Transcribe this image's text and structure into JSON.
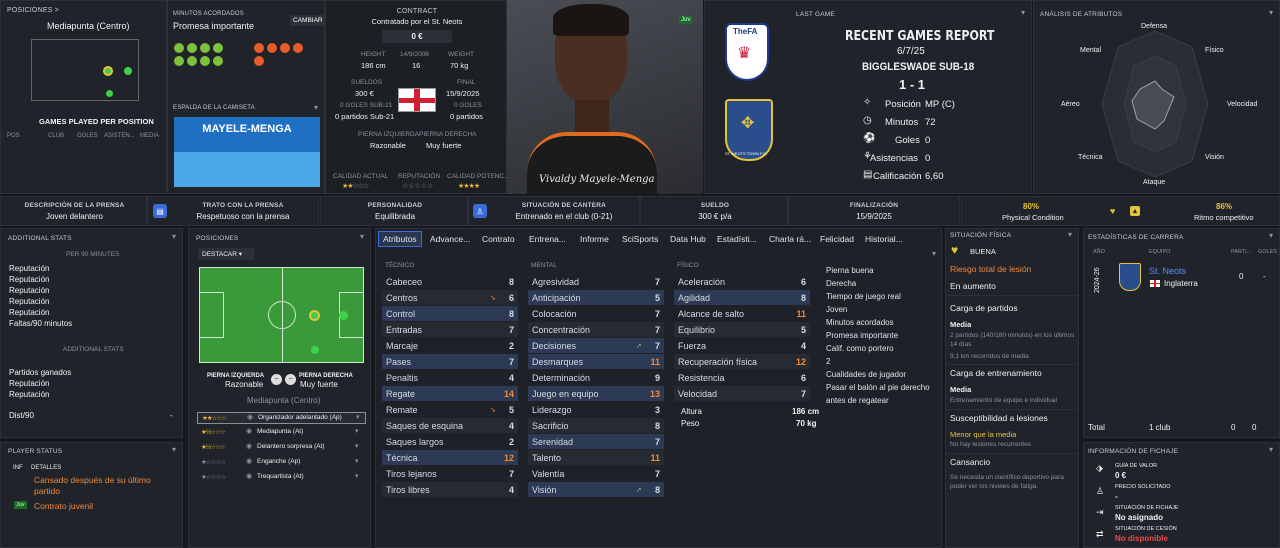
{
  "top": {
    "pos_link": "POSICIONES >",
    "pos_main": "Mediapunta (Centro)",
    "games_per_pos": "GAMES PLAYED PER POSITION",
    "gp_cols": [
      "POS",
      "CLUB",
      "GOLES",
      "ASISTEN...",
      "MEDIA"
    ],
    "minutes_title": "MINUTOS ACORDADOS",
    "minutes_value": "Promesa importante",
    "cambiar": "CAMBIAR",
    "shirt_title": "ESPALDA DE LA CAMISETA",
    "shirt_name": "MAYELE-MENGA",
    "contract_title": "CONTRACT",
    "contract_sub": "Contratado por el St. Neots",
    "contract_value": "0 €",
    "height_l": "HEIGHT",
    "height_v": "186 cm",
    "dob": "14/9/2008",
    "age": "16",
    "weight_l": "WEIGHT",
    "weight_v": "70 kg",
    "wage_l": "SUELDOS",
    "wage_v": "300 €",
    "final_l": "FINAL",
    "final_v": "15/9/2025",
    "goals_l": "0 GOLES SUB-21",
    "goals_v": "0 partidos Sub-21",
    "goals2_l": "0 GOLES",
    "goals2_v": "0 partidos",
    "foot_l_title": "PIERNA IZQUIERDA",
    "foot_l": "Razonable",
    "foot_r_title": "PIERNA DERECHA",
    "foot_r": "Muy fuerte",
    "ca_l": "CALIDAD ACTUAL",
    "rep_l": "REPUTACIÓN",
    "pa_l": "CALIDAD POTENC...",
    "player_name": "Vivaldy Mayele-Menga",
    "youth_badge": "Juv",
    "last_game": "LAST GAME",
    "report_title": "RECENT GAMES REPORT",
    "report_date": "6/7/25",
    "report_team": "BIGGLESWADE SUB-18",
    "report_score": "1 - 1",
    "fa_logo": "TheFA",
    "stn_logo": "ST. NEOTS TOWN F.C.",
    "rep_rows": [
      {
        "l": "Posición",
        "v": "MP (C)"
      },
      {
        "l": "Minutos",
        "v": "72"
      },
      {
        "l": "Goles",
        "v": "0"
      },
      {
        "l": "Asistencias",
        "v": "0"
      },
      {
        "l": "Calificación",
        "v": "6,60"
      }
    ],
    "attr_title": "ANÁLISIS DE ATRIBUTOS",
    "radar": [
      "Defensa",
      "Físico",
      "Velocidad",
      "Visión",
      "Ataque",
      "Técnica",
      "Aéreo",
      "Mental"
    ]
  },
  "strip": [
    {
      "t": "DESCRIPCIÓN DE LA PRENSA",
      "v": "Joven delantero"
    },
    {
      "t": "TRATO CON LA PRENSA",
      "v": "Respetuoso con la prensa"
    },
    {
      "t": "PERSONALIDAD",
      "v": "Equilibrada"
    },
    {
      "t": "SITUACIÓN DE CANTERA",
      "v": "Entrenado en el club (0-21)"
    },
    {
      "t": "SUELDO",
      "v": "300 € p/a"
    },
    {
      "t": "FINALIZACIÓN",
      "v": "15/9/2025"
    },
    {
      "t": "80%",
      "v": "Physical Condition"
    },
    {
      "t": "86%",
      "v": "Ritmo competitivo"
    }
  ],
  "left": {
    "title": "ADDITIONAL STATS",
    "sub1": "PER 90 MINUTES",
    "items1": [
      "Reputación",
      "Reputación",
      "Reputación",
      "Reputación",
      "Reputación",
      "Faltas/90 minutos"
    ],
    "sub2": "ADDITIONAL STATS",
    "items2": [
      "Partidos ganados",
      "Reputación",
      "Reputación"
    ],
    "dist": "Dist/90",
    "dist_v": "-",
    "status_title": "PLAYER STATUS",
    "col1": "INF",
    "col2": "DETALLES",
    "status1": "Cansado después de su último partido",
    "status2": "Contrato juvenil",
    "juv": "Juv"
  },
  "positions": {
    "title": "POSICIONES",
    "dropdown": "DESTACAR",
    "foot_l_title": "PIERNA IZQUIERDA",
    "foot_l": "Razonable",
    "foot_r_title": "PIERNA DERECHA",
    "foot_r": "Muy fuerte",
    "main": "Mediapunta (Centro)",
    "roles": [
      {
        "s": "★★☆☆☆",
        "n": "Organizador adelantado (Ap)"
      },
      {
        "s": "★½☆☆☆",
        "n": "Mediapunta (At)"
      },
      {
        "s": "★½☆☆☆",
        "n": "Delantero sorpresa (At)"
      },
      {
        "s": "★☆☆☆☆",
        "n": "Enganche (Ap)"
      },
      {
        "s": "★☆☆☆☆",
        "n": "Trequartista (At)"
      }
    ]
  },
  "tabs": [
    "Atributos",
    "Advance...",
    "Contrato",
    "Entrena...",
    "Informe",
    "SciSports",
    "Data Hub",
    "Estadísti...",
    "Charla rá...",
    "Felicidad",
    "Historial..."
  ],
  "attrs": {
    "tec_h": "TÉCNICO",
    "men_h": "MENTAL",
    "fis_h": "FÍSICO",
    "tec": [
      {
        "n": "Cabeceo",
        "v": "8"
      },
      {
        "n": "Centros",
        "v": "6"
      },
      {
        "n": "Control",
        "v": "8"
      },
      {
        "n": "Entradas",
        "v": "7"
      },
      {
        "n": "Marcaje",
        "v": "2"
      },
      {
        "n": "Pases",
        "v": "7"
      },
      {
        "n": "Penaltis",
        "v": "4"
      },
      {
        "n": "Regate",
        "v": "14"
      },
      {
        "n": "Remate",
        "v": "5"
      },
      {
        "n": "Saques de esquina",
        "v": "4"
      },
      {
        "n": "Saques largos",
        "v": "2"
      },
      {
        "n": "Técnica",
        "v": "12"
      },
      {
        "n": "Tiros lejanos",
        "v": "7"
      },
      {
        "n": "Tiros libres",
        "v": "4"
      }
    ],
    "men": [
      {
        "n": "Agresividad",
        "v": "7"
      },
      {
        "n": "Anticipación",
        "v": "5"
      },
      {
        "n": "Colocación",
        "v": "7"
      },
      {
        "n": "Concentración",
        "v": "7"
      },
      {
        "n": "Decisiones",
        "v": "7"
      },
      {
        "n": "Desmarques",
        "v": "11"
      },
      {
        "n": "Determinación",
        "v": "9"
      },
      {
        "n": "Juego en equipo",
        "v": "13"
      },
      {
        "n": "Liderazgo",
        "v": "3"
      },
      {
        "n": "Sacrificio",
        "v": "8"
      },
      {
        "n": "Serenidad",
        "v": "7"
      },
      {
        "n": "Talento",
        "v": "11"
      },
      {
        "n": "Valentía",
        "v": "7"
      },
      {
        "n": "Visión",
        "v": "8"
      }
    ],
    "fis": [
      {
        "n": "Aceleración",
        "v": "6"
      },
      {
        "n": "Agilidad",
        "v": "8"
      },
      {
        "n": "Alcance de salto",
        "v": "11"
      },
      {
        "n": "Equilibrio",
        "v": "5"
      },
      {
        "n": "Fuerza",
        "v": "4"
      },
      {
        "n": "Recuperación física",
        "v": "12"
      },
      {
        "n": "Resistencia",
        "v": "6"
      },
      {
        "n": "Velocidad",
        "v": "7"
      }
    ],
    "altura_l": "Altura",
    "altura_v": "186 cm",
    "peso_l": "Peso",
    "peso_v": "70 kg",
    "info": [
      "Pierna buena",
      "Derecha",
      "Tiempo de juego real",
      "Joven",
      "Minutos acordados",
      "Promesa importante",
      "Calif. como portero",
      "2",
      "Cualidades de jugador",
      "Pasar el balón al pie derecho antes de regatear"
    ]
  },
  "fisica": {
    "title": "SITUACIÓN FÍSICA",
    "buena": "BUENA",
    "riesgo": "Riesgo total de lesión",
    "aumento": "En aumento",
    "carga_p": "Carga de partidos",
    "media1": "Media",
    "carga_p_d": "2 partidos (140/180 minutos) en los últimos 14 días",
    "km": "9,1 km recorridos de media",
    "carga_e": "Carga de entrenamiento",
    "media2": "Media",
    "carga_e_d": "Entrenamiento de equipo e individual",
    "suscep": "Susceptibilidad a lesiones",
    "menor": "Menor que la media",
    "norec": "No hay lesiones recurrentes",
    "cansancio": "Cansancio",
    "cansancio_d": "Se necesita un científico deportivo para poder ver los niveles de fatiga."
  },
  "career": {
    "title": "ESTADÍSTICAS DE CARRERA",
    "cols": [
      "AÑO",
      "EQUIPO",
      "PARTI...",
      "GOLES"
    ],
    "year": "2024-26",
    "club": "St. Neots",
    "country": "Inglaterra",
    "p": "0",
    "g": "-",
    "total": "Total",
    "total_club": "1 club",
    "total_p": "0",
    "total_g": "0"
  },
  "fichaje": {
    "title": "INFORMACIÓN DE FICHAJE",
    "items": [
      {
        "t": "GUÍA DE VALOR",
        "v": "0 €"
      },
      {
        "t": "PRECIO SOLICITADO",
        "v": "-"
      },
      {
        "t": "SITUACIÓN DE FICHAJE",
        "v": "No asignado"
      },
      {
        "t": "SITUACIÓN DE CESIÓN",
        "v": "No disponible"
      }
    ]
  },
  "colors": {
    "accent": "#3b6bd6",
    "orange": "#f08a3c",
    "yellow": "#e6c43a",
    "red": "#e94b4b",
    "green": "#5fcf6a",
    "shirt_light": "#4aa9e6",
    "shirt_dark": "#1f6fc4"
  }
}
